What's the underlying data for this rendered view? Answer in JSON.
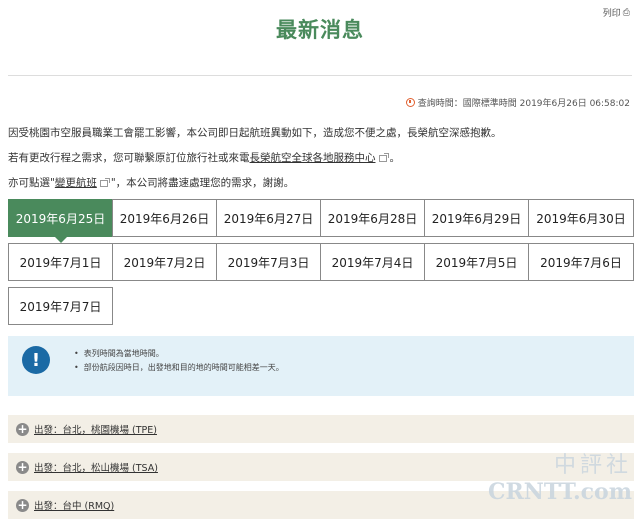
{
  "print": {
    "label": "列印"
  },
  "header": {
    "title": "最新消息"
  },
  "query_time": {
    "label": "查詢時間：國際標準時間 2019年6月26日 06:58:02"
  },
  "messages": {
    "line1": "因受桃園市空服員職業工會罷工影響，本公司即日起航班異動如下，造成您不便之處，長榮航空深感抱歉。",
    "line2_prefix": "若有更改行程之需求，您可聯繫原訂位旅行社或來電",
    "line2_link": "長榮航空全球各地服務中心",
    "line2_suffix": "。",
    "line3_prefix": "亦可點選\"",
    "line3_link": "變更航班",
    "line3_suffix": "\"，本公司將盡速處理您的需求，謝謝。"
  },
  "date_tabs": [
    "2019年6月25日",
    "2019年6月26日",
    "2019年6月27日",
    "2019年6月28日",
    "2019年6月29日",
    "2019年6月30日",
    "2019年7月1日",
    "2019年7月2日",
    "2019年7月3日",
    "2019年7月4日",
    "2019年7月5日",
    "2019年7月6日",
    "2019年7月7日"
  ],
  "active_tab": "2019年6月25日",
  "notice": {
    "icon": "exclamation-icon",
    "items": [
      "表列時間為當地時間。",
      "部份航段因時日，出發地和目的地的時間可能相差一天。"
    ]
  },
  "departures": [
    "出發：台北，桃園機場 (TPE)",
    "出發：台北，松山機場 (TSA)",
    "出發：台中 (RMQ)"
  ],
  "watermark": {
    "line1": "中評社",
    "line2": "CRNTT.com"
  },
  "colors": {
    "accent": "#4a8a5c",
    "notice_bg": "#e3f1f8",
    "accordion_bg": "#f3efe6",
    "info_icon": "#1b6aa5"
  }
}
